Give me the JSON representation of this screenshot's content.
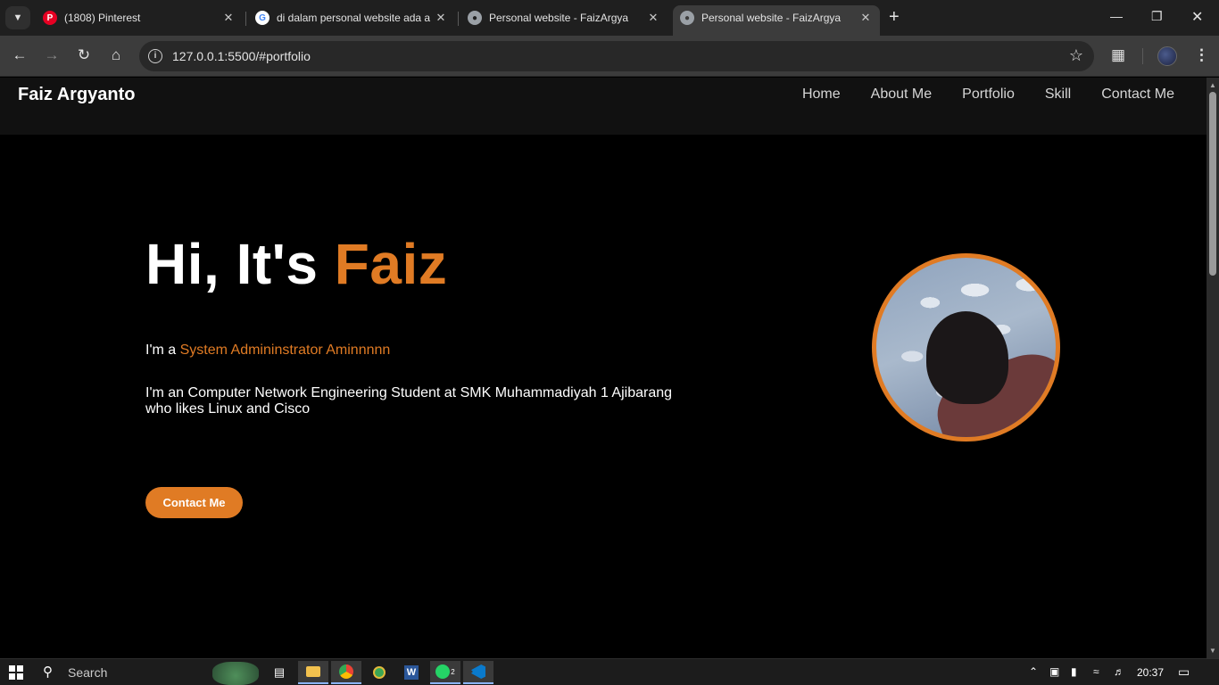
{
  "browser": {
    "tabs": [
      {
        "title": "(1808) Pinterest",
        "favicon": "pinterest-icon"
      },
      {
        "title": "di dalam personal website ada a",
        "favicon": "google-icon"
      },
      {
        "title": "Personal website - FaizArgya",
        "favicon": "globe-icon"
      },
      {
        "title": "Personal website - FaizArgya",
        "favicon": "globe-icon"
      }
    ],
    "url": "127.0.0.1:5500/#portfolio"
  },
  "site": {
    "brand": "Faiz Argyanto",
    "nav": [
      "Home",
      "About Me",
      "Portfolio",
      "Skill",
      "Contact Me"
    ],
    "hero": {
      "greeting": "Hi, It's ",
      "name": "Faiz",
      "role_prefix": "I'm a ",
      "role": "System Admininstrator Aminnnnn",
      "description": "I'm an Computer Network Engineering Student at SMK Muhammadiyah 1 Ajibarang who likes Linux and Cisco",
      "cta_label": "Contact Me"
    },
    "accent_color": "#e07b24"
  },
  "taskbar": {
    "search_label": "Search",
    "clock": "20:37",
    "whatsapp_badge": "2"
  }
}
